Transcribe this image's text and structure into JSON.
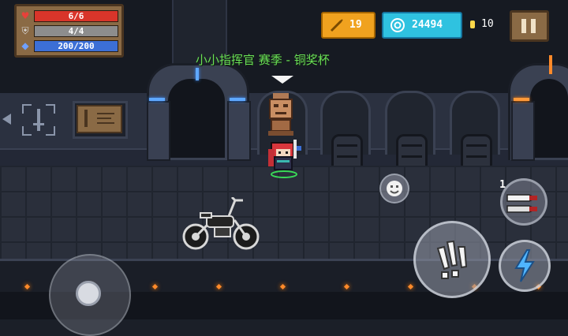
{
  "hud": {
    "hp": "6/6",
    "armor": "4/4",
    "energy": "200/200",
    "gold": "19",
    "gems": "24494",
    "coins": "10"
  },
  "banner": {
    "text": "小小指挥官 赛季 - 铜奖杯"
  },
  "weapon": {
    "slot_count": "1"
  },
  "icons": {
    "hp": "heart-icon",
    "armor": "shield-icon",
    "energy": "diamond-icon",
    "gold": "fish-icon",
    "gems": "gem-icon",
    "coins": "coin-icon",
    "pause": "pause-icon",
    "emote": "smiley-icon",
    "attack": "claw-slash-icon",
    "skill": "lightning-bolt-icon",
    "weapon": "dual-knives-icon"
  },
  "colors": {
    "banner_text": "#6adf57",
    "hp_bar": "#d9352a",
    "armor_bar": "#8d8d8d",
    "energy_bar": "#3c6fd6",
    "gold_button": "#f0a21f",
    "gem_button": "#2fc2e0",
    "skill_bolt": "#4fb4ff"
  }
}
